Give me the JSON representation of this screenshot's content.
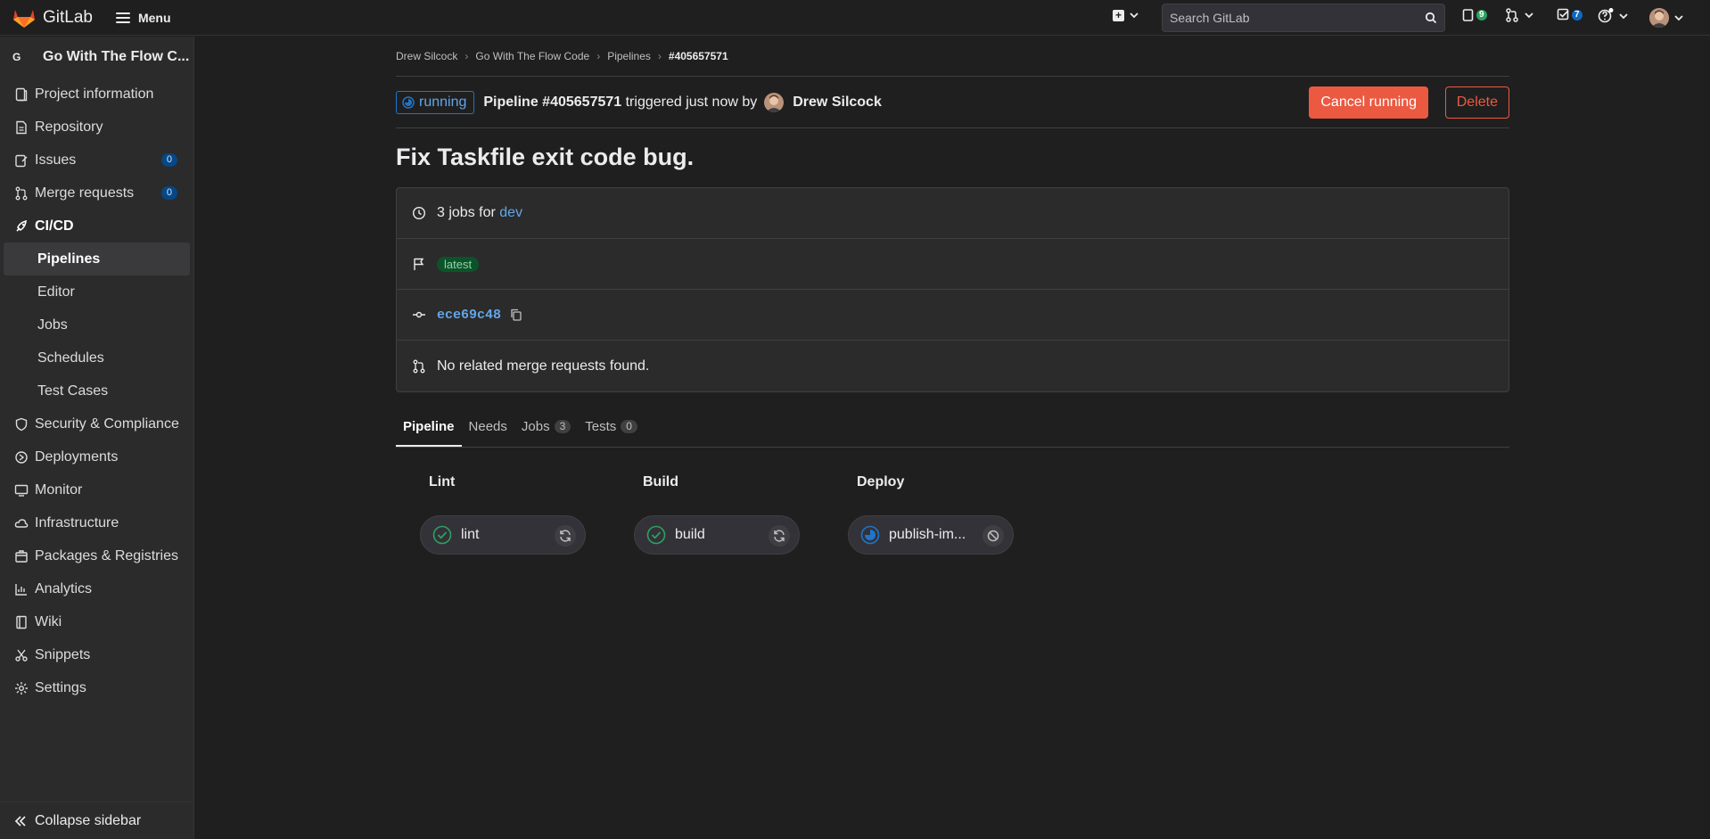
{
  "topbar": {
    "brand": "GitLab",
    "menu_label": "Menu",
    "search_placeholder": "Search GitLab",
    "issues_count": "9",
    "todos_count": "7"
  },
  "sidebar": {
    "project_avatar": "G",
    "project_name": "Go With The Flow C...",
    "items": [
      {
        "label": "Project information",
        "icon": "project-icon"
      },
      {
        "label": "Repository",
        "icon": "doc-icon"
      },
      {
        "label": "Issues",
        "icon": "issues-icon",
        "count": "0"
      },
      {
        "label": "Merge requests",
        "icon": "merge-request-icon",
        "count": "0"
      },
      {
        "label": "CI/CD",
        "icon": "rocket-icon"
      }
    ],
    "cicd_sub": [
      "Pipelines",
      "Editor",
      "Jobs",
      "Schedules",
      "Test Cases"
    ],
    "items_after": [
      {
        "label": "Security & Compliance",
        "icon": "shield-icon"
      },
      {
        "label": "Deployments",
        "icon": "deployments-icon"
      },
      {
        "label": "Monitor",
        "icon": "monitor-icon"
      },
      {
        "label": "Infrastructure",
        "icon": "cloud-icon"
      },
      {
        "label": "Packages & Registries",
        "icon": "package-icon"
      },
      {
        "label": "Analytics",
        "icon": "chart-icon"
      },
      {
        "label": "Wiki",
        "icon": "book-icon"
      },
      {
        "label": "Snippets",
        "icon": "scissors-icon"
      },
      {
        "label": "Settings",
        "icon": "gear-icon"
      }
    ],
    "collapse_label": "Collapse sidebar"
  },
  "breadcrumb": [
    "Drew Silcock",
    "Go With The Flow Code",
    "Pipelines",
    "#405657571"
  ],
  "pipeline": {
    "status": "running",
    "id_label": "Pipeline #405657571",
    "triggered_text": "triggered just now by",
    "user": "Drew Silcock",
    "cancel_label": "Cancel running",
    "delete_label": "Delete",
    "commit_title": "Fix Taskfile exit code bug.",
    "jobs_text": "3 jobs for",
    "branch": "dev",
    "tag": "latest",
    "commit_sha": "ece69c48",
    "mr_text": "No related merge requests found."
  },
  "tabs": [
    {
      "label": "Pipeline"
    },
    {
      "label": "Needs"
    },
    {
      "label": "Jobs",
      "count": "3"
    },
    {
      "label": "Tests",
      "count": "0"
    }
  ],
  "stages": [
    {
      "name": "Lint",
      "job": "lint",
      "status": "success",
      "action": "retry"
    },
    {
      "name": "Build",
      "job": "build",
      "status": "success",
      "action": "retry"
    },
    {
      "name": "Deploy",
      "job": "publish-im...",
      "status": "running",
      "action": "cancel"
    }
  ],
  "colors": {
    "accent": "#63a6e9",
    "success": "#2da160",
    "danger": "#ec5941"
  }
}
